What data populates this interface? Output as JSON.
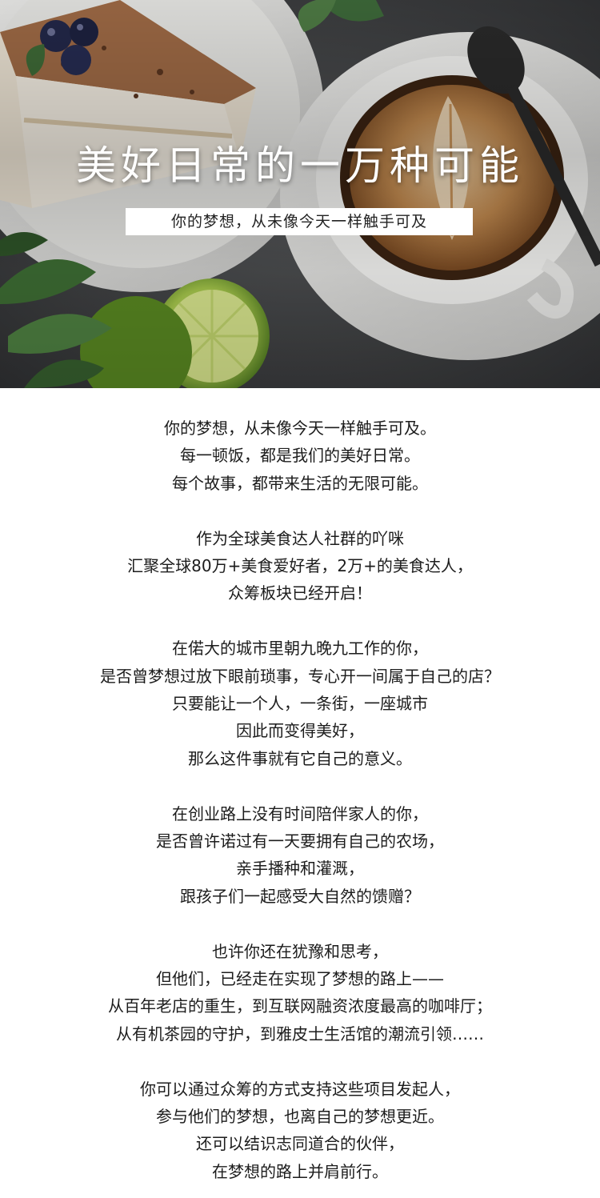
{
  "hero": {
    "title": "美好日常的一万种可能",
    "subtitle": "你的梦想，从未像今天一样触手可及"
  },
  "paragraphs": [
    {
      "lines": [
        "你的梦想，从未像今天一样触手可及。",
        "每一顿饭，都是我们的美好日常。",
        "每个故事，都带来生活的无限可能。"
      ]
    },
    {
      "lines": [
        "作为全球美食达人社群的吖咪",
        "汇聚全球80万+美食爱好者，2万+的美食达人，",
        "众筹板块已经开启！"
      ]
    },
    {
      "lines": [
        "在偌大的城市里朝九晚九工作的你，",
        "是否曾梦想过放下眼前琐事，专心开一间属于自己的店？",
        "只要能让一个人，一条街，一座城市",
        "因此而变得美好，",
        "那么这件事就有它自己的意义。"
      ]
    },
    {
      "lines": [
        "在创业路上没有时间陪伴家人的你，",
        "是否曾许诺过有一天要拥有自己的农场，",
        "亲手播种和灌溉，",
        "跟孩子们一起感受大自然的馈赠？"
      ]
    },
    {
      "lines": [
        "也许你还在犹豫和思考，",
        "但他们，已经走在实现了梦想的路上——",
        "从百年老店的重生，到互联网融资浓度最高的咖啡厅；",
        "从有机茶园的守护，到雅皮士生活馆的潮流引领……"
      ]
    },
    {
      "lines": [
        "你可以通过众筹的方式支持这些项目发起人，",
        "参与他们的梦想，也离自己的梦想更近。",
        "还可以结识志同道合的伙伴，",
        "在梦想的路上并肩前行。"
      ]
    }
  ]
}
